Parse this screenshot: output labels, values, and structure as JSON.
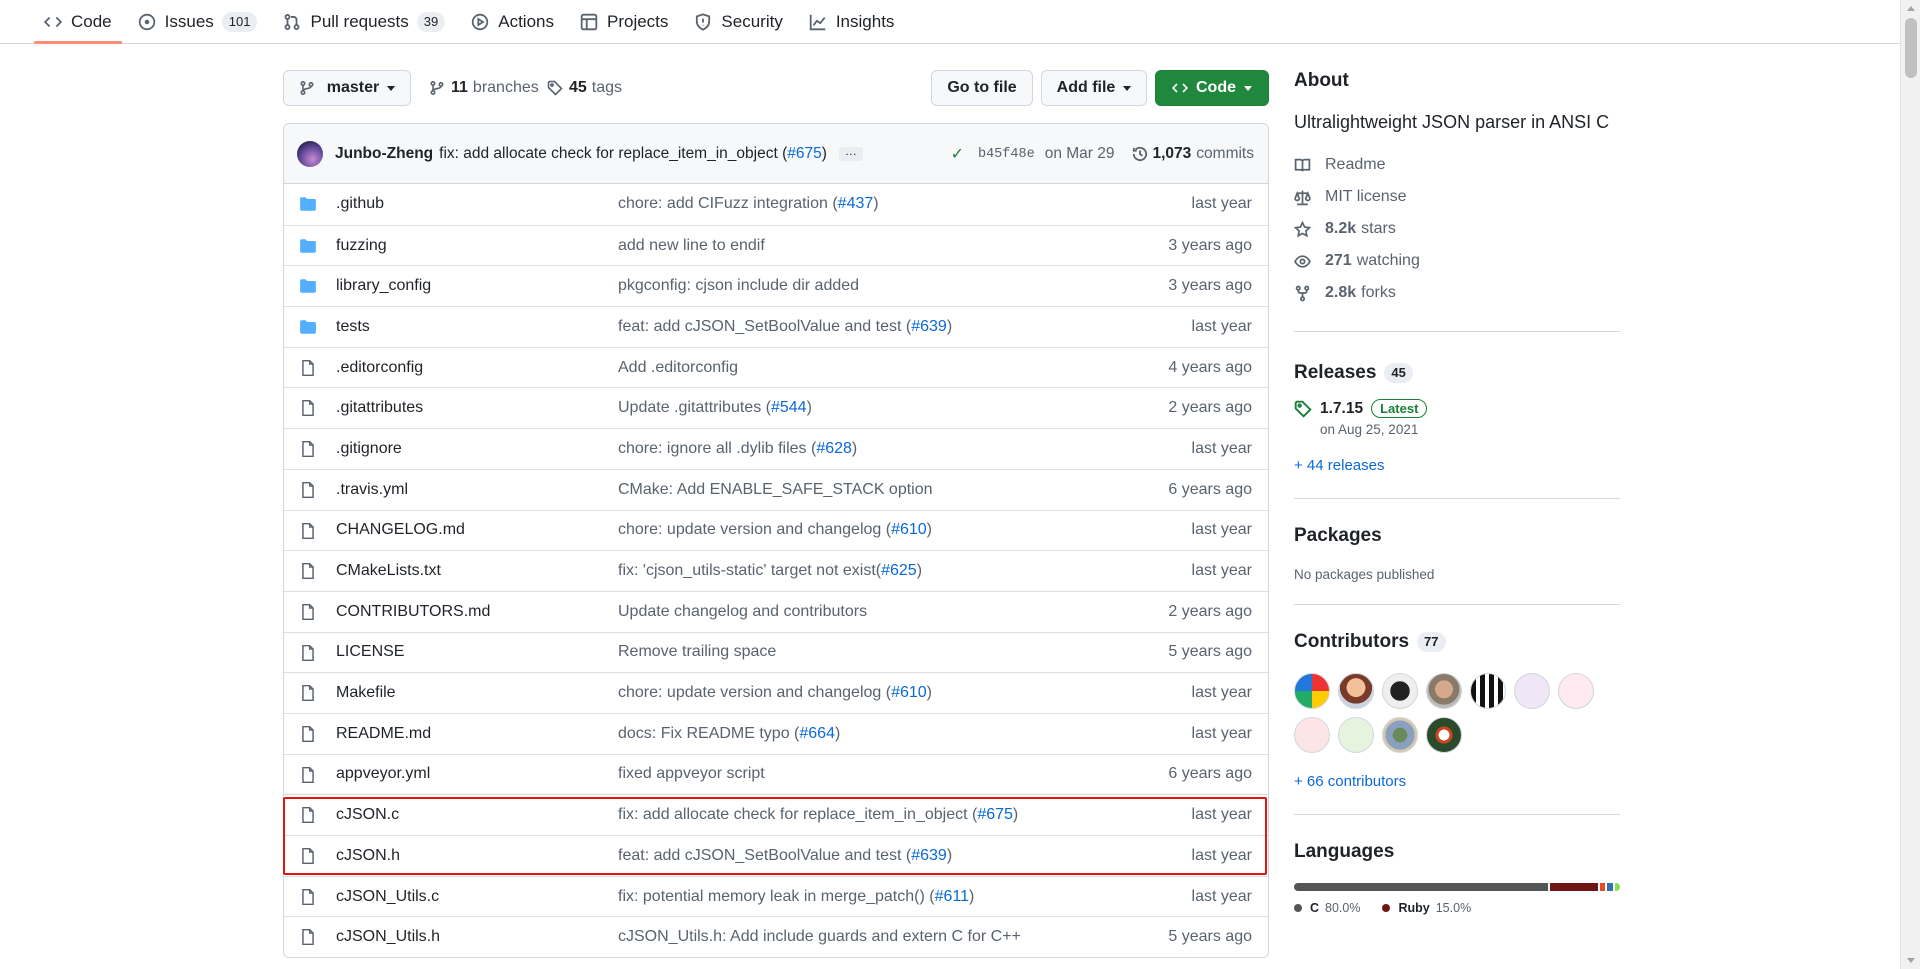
{
  "nav": {
    "tabs": [
      {
        "label": "Code",
        "icon": "code-icon",
        "counter": null
      },
      {
        "label": "Issues",
        "icon": "issue-icon",
        "counter": "101"
      },
      {
        "label": "Pull requests",
        "icon": "pull-request-icon",
        "counter": "39"
      },
      {
        "label": "Actions",
        "icon": "play-icon",
        "counter": null
      },
      {
        "label": "Projects",
        "icon": "table-icon",
        "counter": null
      },
      {
        "label": "Security",
        "icon": "shield-icon",
        "counter": null
      },
      {
        "label": "Insights",
        "icon": "graph-icon",
        "counter": null
      }
    ]
  },
  "toolbar": {
    "branch": "master",
    "branches_count": "11",
    "branches_label": "branches",
    "tags_count": "45",
    "tags_label": "tags",
    "go_to_file": "Go to file",
    "add_file": "Add file",
    "code": "Code"
  },
  "commit": {
    "author": "Junbo-Zheng",
    "message": "fix: add allocate check for replace_item_in_object (",
    "pr": "#675",
    "message_end": ")",
    "ellipsis": "…",
    "sha": "b45f48e",
    "date": "on Mar 29",
    "commits_count": "1,073",
    "commits_label": "commits"
  },
  "files": [
    {
      "name": ".github",
      "type": "dir",
      "msg": "chore: add CIFuzz integration (",
      "pr": "#437",
      "end": ")",
      "age": "last year"
    },
    {
      "name": "fuzzing",
      "type": "dir",
      "msg": "add new line to endif",
      "pr": "",
      "end": "",
      "age": "3 years ago"
    },
    {
      "name": "library_config",
      "type": "dir",
      "msg": "pkgconfig: cjson include dir added",
      "pr": "",
      "end": "",
      "age": "3 years ago"
    },
    {
      "name": "tests",
      "type": "dir",
      "msg": "feat: add cJSON_SetBoolValue and test (",
      "pr": "#639",
      "end": ")",
      "age": "last year"
    },
    {
      "name": ".editorconfig",
      "type": "file",
      "msg": "Add .editorconfig",
      "pr": "",
      "end": "",
      "age": "4 years ago"
    },
    {
      "name": ".gitattributes",
      "type": "file",
      "msg": "Update .gitattributes (",
      "pr": "#544",
      "end": ")",
      "age": "2 years ago"
    },
    {
      "name": ".gitignore",
      "type": "file",
      "msg": "chore: ignore all .dylib files (",
      "pr": "#628",
      "end": ")",
      "age": "last year"
    },
    {
      "name": ".travis.yml",
      "type": "file",
      "msg": "CMake: Add ENABLE_SAFE_STACK option",
      "pr": "",
      "end": "",
      "age": "6 years ago"
    },
    {
      "name": "CHANGELOG.md",
      "type": "file",
      "msg": "chore: update version and changelog (",
      "pr": "#610",
      "end": ")",
      "age": "last year"
    },
    {
      "name": "CMakeLists.txt",
      "type": "file",
      "msg": "fix: 'cjson_utils-static' target not exist(",
      "pr": "#625",
      "end": ")",
      "age": "last year"
    },
    {
      "name": "CONTRIBUTORS.md",
      "type": "file",
      "msg": "Update changelog and contributors",
      "pr": "",
      "end": "",
      "age": "2 years ago"
    },
    {
      "name": "LICENSE",
      "type": "file",
      "msg": "Remove trailing space",
      "pr": "",
      "end": "",
      "age": "5 years ago"
    },
    {
      "name": "Makefile",
      "type": "file",
      "msg": "chore: update version and changelog (",
      "pr": "#610",
      "end": ")",
      "age": "last year"
    },
    {
      "name": "README.md",
      "type": "file",
      "msg": "docs: Fix README typo (",
      "pr": "#664",
      "end": ")",
      "age": "last year"
    },
    {
      "name": "appveyor.yml",
      "type": "file",
      "msg": "fixed appveyor script",
      "pr": "",
      "end": "",
      "age": "6 years ago"
    },
    {
      "name": "cJSON.c",
      "type": "file",
      "msg": "fix: add allocate check for replace_item_in_object (",
      "pr": "#675",
      "end": ")",
      "age": "last year"
    },
    {
      "name": "cJSON.h",
      "type": "file",
      "msg": "feat: add cJSON_SetBoolValue and test (",
      "pr": "#639",
      "end": ")",
      "age": "last year"
    },
    {
      "name": "cJSON_Utils.c",
      "type": "file",
      "msg": "fix: potential memory leak in merge_patch() (",
      "pr": "#611",
      "end": ")",
      "age": "last year"
    },
    {
      "name": "cJSON_Utils.h",
      "type": "file",
      "msg": "cJSON_Utils.h: Add include guards and extern C for C++",
      "pr": "",
      "end": "",
      "age": "5 years ago"
    }
  ],
  "about": {
    "title": "About",
    "description": "Ultralightweight JSON parser in ANSI C",
    "items": [
      {
        "icon": "book-icon",
        "bold": "",
        "label": "Readme"
      },
      {
        "icon": "law-icon",
        "bold": "",
        "label": "MIT license"
      },
      {
        "icon": "star-icon",
        "bold": "8.2k",
        "label": "stars"
      },
      {
        "icon": "eye-icon",
        "bold": "271",
        "label": "watching"
      },
      {
        "icon": "fork-icon",
        "bold": "2.8k",
        "label": "forks"
      }
    ]
  },
  "releases": {
    "title": "Releases",
    "count": "45",
    "version": "1.7.15",
    "badge": "Latest",
    "date": "on Aug 25, 2021",
    "more": "+ 44 releases"
  },
  "packages": {
    "title": "Packages",
    "text": "No packages published"
  },
  "contributors": {
    "title": "Contributors",
    "count": "77",
    "more": "+ 66 contributors"
  },
  "languages": {
    "title": "Languages",
    "items": [
      {
        "name": "C",
        "percent": "80.0%",
        "share": 80.0,
        "color": "#555555"
      },
      {
        "name": "Ruby",
        "percent": "15.0%",
        "share": 15.0,
        "color": "#701516"
      }
    ],
    "other_colors": [
      "#e34c26",
      "#3572A5",
      "#89e051"
    ]
  },
  "colors": {
    "accent": "#0969da",
    "success": "#1f883d",
    "highlight": "#e3150e"
  }
}
